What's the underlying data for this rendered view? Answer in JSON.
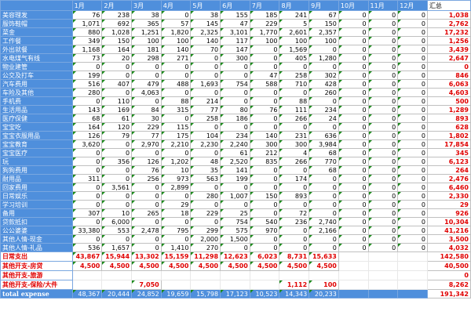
{
  "headers": [
    "",
    "1月",
    "2月",
    "3月",
    "4月",
    "5月",
    "6月",
    "7月",
    "8月",
    "9月",
    "10月",
    "11月",
    "12月",
    "汇总"
  ],
  "rows": [
    {
      "label": "美容理发",
      "values": [
        "76",
        "238",
        "38",
        "0",
        "38",
        "155",
        "185",
        "241",
        "67",
        "0",
        "0",
        "0"
      ],
      "total": "1,038"
    },
    {
      "label": "服饰鞋帽",
      "values": [
        "1,071",
        "692",
        "365",
        "57",
        "145",
        "47",
        "229",
        "5",
        "150",
        "0",
        "0",
        "0"
      ],
      "total": "2,762"
    },
    {
      "label": "菜金",
      "values": [
        "880",
        "1,028",
        "1,251",
        "1,820",
        "2,325",
        "3,101",
        "1,770",
        "2,601",
        "2,357",
        "0",
        "0",
        "0"
      ],
      "total": "17,232"
    },
    {
      "label": "工作餐",
      "values": [
        "349",
        "150",
        "100",
        "100",
        "140",
        "117",
        "100",
        "100",
        "100",
        "0",
        "0",
        "0"
      ],
      "total": "1,256"
    },
    {
      "label": "外出就餐",
      "values": [
        "1,168",
        "164",
        "181",
        "140",
        "70",
        "147",
        "0",
        "1,569",
        "0",
        "0",
        "0",
        "0"
      ],
      "total": "3,439"
    },
    {
      "label": "水电煤气有线",
      "values": [
        "73",
        "20",
        "298",
        "271",
        "0",
        "300",
        "0",
        "405",
        "1,280",
        "0",
        "0",
        "0"
      ],
      "total": "2,647"
    },
    {
      "label": "物业建管",
      "values": [
        "0",
        "0",
        "0",
        "0",
        "0",
        "0",
        "0",
        "0",
        "0",
        "0",
        "0",
        "0"
      ],
      "total": "0"
    },
    {
      "label": "公交及打车",
      "values": [
        "199",
        "0",
        "0",
        "0",
        "0",
        "0",
        "47",
        "258",
        "302",
        "0",
        "0",
        "0"
      ],
      "total": "846"
    },
    {
      "label": "汽车费用",
      "values": [
        "516",
        "407",
        "479",
        "488",
        "1,693",
        "754",
        "588",
        "710",
        "428",
        "0",
        "0",
        "0"
      ],
      "total": "6,063"
    },
    {
      "label": "车险及其他",
      "values": [
        "280",
        "0",
        "4,063",
        "0",
        "0",
        "0",
        "0",
        "0",
        "260",
        "0",
        "0",
        "0"
      ],
      "total": "4,603"
    },
    {
      "label": "手机费",
      "values": [
        "0",
        "110",
        "0",
        "88",
        "214",
        "0",
        "0",
        "88",
        "0",
        "0",
        "0",
        "0"
      ],
      "total": "500"
    },
    {
      "label": "生活用品",
      "values": [
        "143",
        "169",
        "84",
        "315",
        "77",
        "80",
        "76",
        "111",
        "234",
        "0",
        "0",
        "0"
      ],
      "total": "1,289"
    },
    {
      "label": "医疗保健",
      "values": [
        "68",
        "61",
        "30",
        "0",
        "258",
        "186",
        "0",
        "266",
        "24",
        "0",
        "0",
        "0"
      ],
      "total": "893"
    },
    {
      "label": "宝宝吃",
      "values": [
        "164",
        "120",
        "229",
        "115",
        "0",
        "0",
        "0",
        "0",
        "0",
        "0",
        "0",
        "0"
      ],
      "total": "628"
    },
    {
      "label": "宝宝衣服用品",
      "values": [
        "126",
        "79",
        "77",
        "175",
        "104",
        "234",
        "140",
        "231",
        "636",
        "0",
        "0",
        "0"
      ],
      "total": "1,802"
    },
    {
      "label": "宝宝教育",
      "values": [
        "3,620",
        "0",
        "2,970",
        "2,210",
        "2,230",
        "2,240",
        "300",
        "300",
        "3,984",
        "0",
        "0",
        "0"
      ],
      "total": "17,854"
    },
    {
      "label": "宝宝医疗",
      "values": [
        "0",
        "0",
        "0",
        "0",
        "0",
        "61",
        "212",
        "4",
        "68",
        "0",
        "0",
        "0"
      ],
      "total": "345"
    },
    {
      "label": "玩",
      "values": [
        "0",
        "356",
        "126",
        "1,202",
        "48",
        "2,520",
        "835",
        "266",
        "770",
        "0",
        "0",
        "0"
      ],
      "total": "6,123"
    },
    {
      "label": "狗狗费用",
      "values": [
        "0",
        "0",
        "76",
        "10",
        "35",
        "141",
        "0",
        "0",
        "68",
        "0",
        "0",
        "0"
      ],
      "total": "264"
    },
    {
      "label": "耐用品",
      "values": [
        "311",
        "0",
        "256",
        "973",
        "563",
        "199",
        "0",
        "174",
        "0",
        "0",
        "0",
        "0"
      ],
      "total": "2,476"
    },
    {
      "label": "回家费用",
      "values": [
        "0",
        "3,561",
        "0",
        "2,899",
        "0",
        "0",
        "0",
        "0",
        "0",
        "0",
        "0",
        "0"
      ],
      "total": "6,460"
    },
    {
      "label": "日常娱乐",
      "values": [
        "0",
        "0",
        "0",
        "0",
        "280",
        "1,007",
        "150",
        "893",
        "0",
        "0",
        "0",
        "0"
      ],
      "total": "2,330"
    },
    {
      "label": "学习培训",
      "values": [
        "0",
        "0",
        "0",
        "29",
        "0",
        "0",
        "0",
        "0",
        "0",
        "0",
        "0",
        "0"
      ],
      "total": "29"
    },
    {
      "label": "备用",
      "values": [
        "307",
        "10",
        "265",
        "18",
        "229",
        "25",
        "0",
        "72",
        "0",
        "0",
        "0",
        "0"
      ],
      "total": "926"
    },
    {
      "label": "贷款抵扣",
      "values": [
        "0",
        "6,000",
        "0",
        "0",
        "0",
        "754",
        "540",
        "236",
        "2,740",
        "0",
        "0",
        "0"
      ],
      "total": "10,304"
    },
    {
      "label": "公公婆婆",
      "values": [
        "33,380",
        "553",
        "2,478",
        "795",
        "299",
        "575",
        "970",
        "0",
        "2,166",
        "0",
        "0",
        "0"
      ],
      "total": "41,216"
    },
    {
      "label": "其他人情-现金",
      "values": [
        "0",
        "0",
        "0",
        "0",
        "2,000",
        "1,500",
        "0",
        "0",
        "0",
        "0",
        "0",
        "0"
      ],
      "total": "3,500"
    },
    {
      "label": "其他人情-礼品",
      "values": [
        "536",
        "1,657",
        "0",
        "1,410",
        "270",
        "0",
        "0",
        "0",
        "0",
        "0",
        "0",
        "0"
      ],
      "total": "4,032"
    }
  ],
  "summary": [
    {
      "label": "日常支出",
      "values": [
        "43,867",
        "15,944",
        "13,302",
        "15,159",
        "11,298",
        "12,623",
        "6,023",
        "8,731",
        "15,633",
        "",
        "",
        ""
      ],
      "total": "142,580"
    },
    {
      "label": "其他开支-房贷",
      "values": [
        "4,500",
        "4,500",
        "4,500",
        "4,500",
        "4,500",
        "4,500",
        "4,500",
        "4,500",
        "4,500",
        "",
        "",
        ""
      ],
      "total": "40,500"
    },
    {
      "label": "其他开支-旅游",
      "values": [
        "",
        "",
        "",
        "",
        "",
        "",
        "",
        "",
        "",
        "",
        "",
        ""
      ],
      "total": "0"
    },
    {
      "label": "其他开支-保险/大件",
      "values": [
        "",
        "",
        "7,050",
        "",
        "",
        "",
        "",
        "1,112",
        "100",
        "",
        "",
        ""
      ],
      "total": "8,262"
    }
  ],
  "total_expense": {
    "label": "total expense",
    "values": [
      "48,367",
      "20,444",
      "24,852",
      "19,659",
      "15,798",
      "17,123",
      "10,523",
      "14,343",
      "20,233",
      "",
      "",
      ""
    ],
    "total": "191,342"
  }
}
